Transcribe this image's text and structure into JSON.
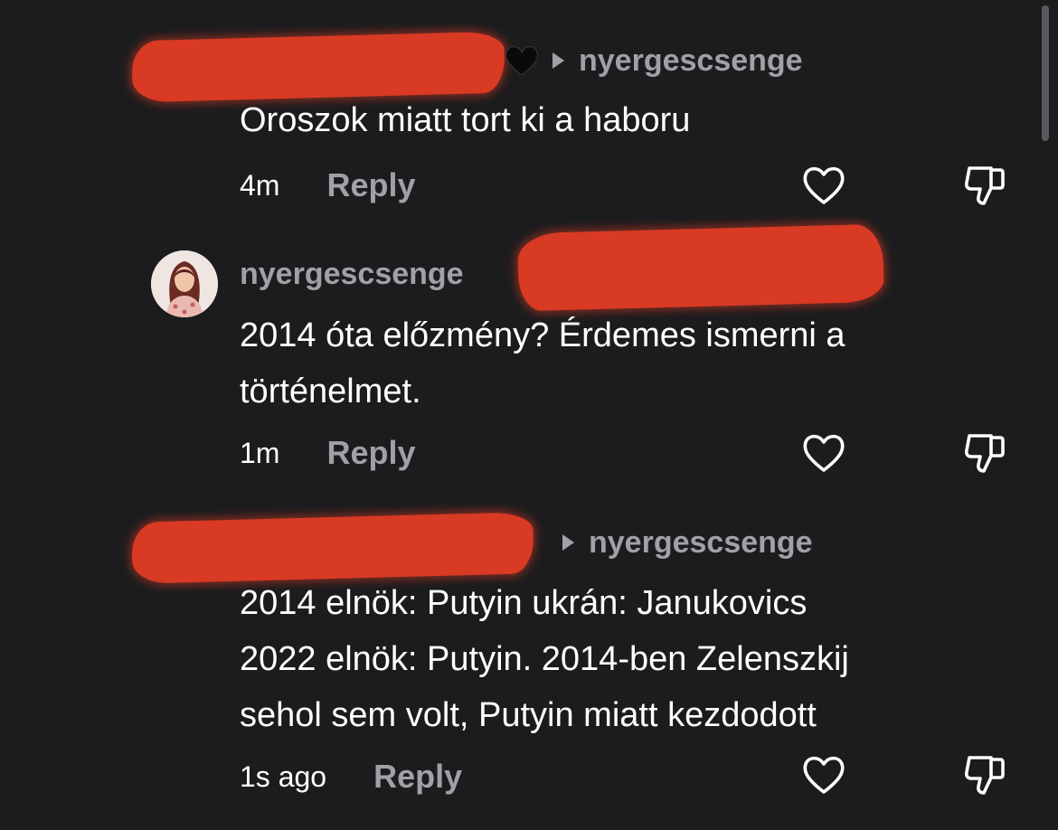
{
  "comments": [
    {
      "reply_to": "nyergescsenge",
      "text": "Oroszok miatt tort ki a haboru",
      "time": "4m",
      "reply_label": "Reply",
      "heart_emoji": "🖤"
    },
    {
      "author": "nyergescsenge",
      "text": "2014 óta előzmény? Érdemes ismerni a\ntörténelmet.",
      "time": "1m",
      "reply_label": "Reply"
    },
    {
      "reply_to": "nyergescsenge",
      "text": "2014 elnök: Putyin ukrán: Janukovics\n2022 elnök: Putyin. 2014-ben Zelenszkij\nsehol sem volt, Putyin miatt kezdodott",
      "time": "1s ago",
      "reply_label": "Reply"
    }
  ],
  "colors": {
    "background": "#1c1c1e",
    "muted_text": "#a0a0a5",
    "censor_mark": "#d83a24"
  },
  "icons": [
    "heart-outline-icon",
    "dislike-icon",
    "caret-right-icon",
    "black-heart-emoji"
  ]
}
